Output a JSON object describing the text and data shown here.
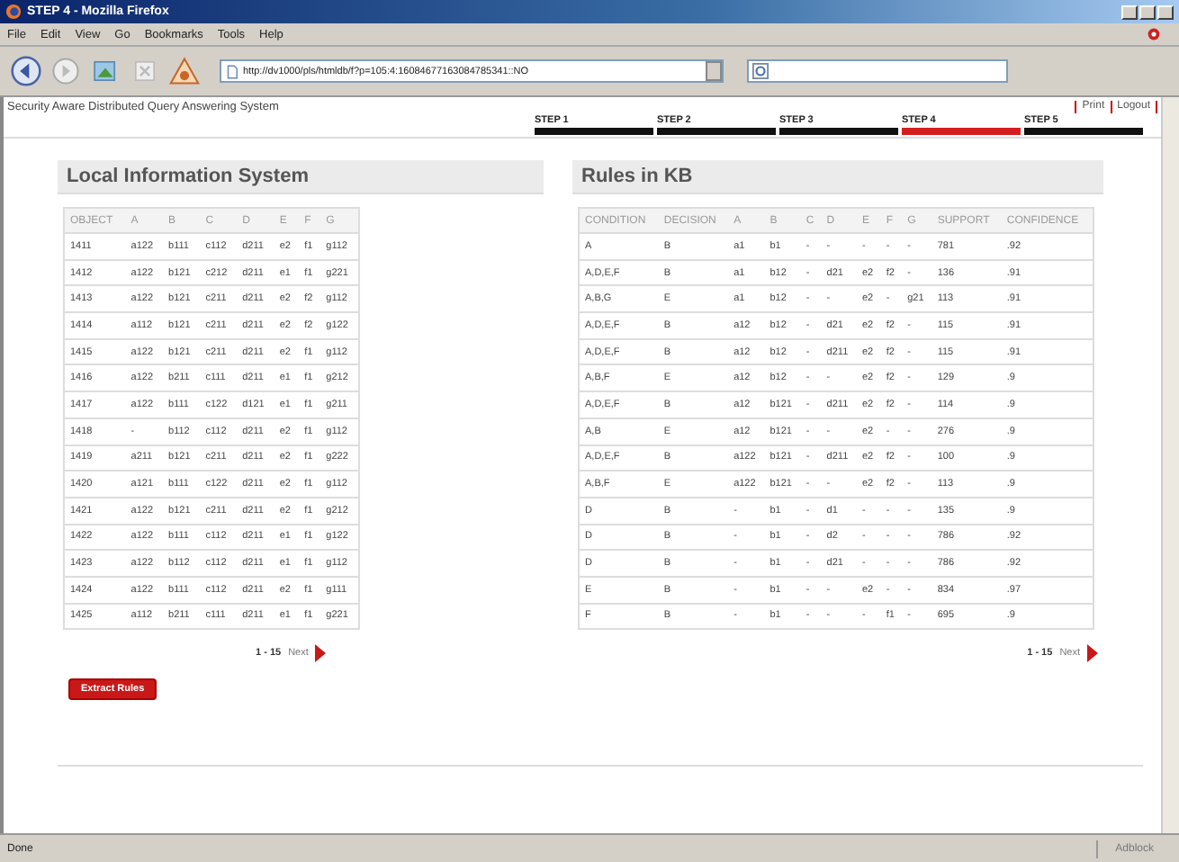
{
  "window": {
    "title": "STEP 4 - Mozilla Firefox",
    "menu": [
      "File",
      "Edit",
      "View",
      "Go",
      "Bookmarks",
      "Tools",
      "Help"
    ],
    "address": "http://dv1000/pls/htmldb/f?p=105:4:16084677163084785341::NO",
    "status": "Done",
    "status_addon": "Adblock"
  },
  "page": {
    "app_title": "Security Aware Distributed Query Answering System",
    "links": [
      "Print",
      "Logout"
    ],
    "steps": [
      {
        "label": "STEP 1",
        "selected": false
      },
      {
        "label": "STEP 2",
        "selected": false
      },
      {
        "label": "STEP 3",
        "selected": false
      },
      {
        "label": "STEP 4",
        "selected": true
      },
      {
        "label": "STEP 5",
        "selected": false
      }
    ],
    "local": {
      "title": "Local Information System",
      "columns": [
        "OBJECT",
        "A",
        "B",
        "C",
        "D",
        "E",
        "F",
        "G"
      ],
      "rows": [
        [
          "1411",
          "a122",
          "b111",
          "c112",
          "d211",
          "e2",
          "f1",
          "g112"
        ],
        [
          "1412",
          "a122",
          "b121",
          "c212",
          "d211",
          "e1",
          "f1",
          "g221"
        ],
        [
          "1413",
          "a122",
          "b121",
          "c211",
          "d211",
          "e2",
          "f2",
          "g112"
        ],
        [
          "1414",
          "a112",
          "b121",
          "c211",
          "d211",
          "e2",
          "f2",
          "g122"
        ],
        [
          "1415",
          "a122",
          "b121",
          "c211",
          "d211",
          "e2",
          "f1",
          "g112"
        ],
        [
          "1416",
          "a122",
          "b211",
          "c111",
          "d211",
          "e1",
          "f1",
          "g212"
        ],
        [
          "1417",
          "a122",
          "b111",
          "c122",
          "d121",
          "e1",
          "f1",
          "g211"
        ],
        [
          "1418",
          "-",
          "b112",
          "c112",
          "d211",
          "e2",
          "f1",
          "g112"
        ],
        [
          "1419",
          "a211",
          "b121",
          "c211",
          "d211",
          "e2",
          "f1",
          "g222"
        ],
        [
          "1420",
          "a121",
          "b111",
          "c122",
          "d211",
          "e2",
          "f1",
          "g112"
        ],
        [
          "1421",
          "a122",
          "b121",
          "c211",
          "d211",
          "e2",
          "f1",
          "g212"
        ],
        [
          "1422",
          "a122",
          "b111",
          "c112",
          "d211",
          "e1",
          "f1",
          "g122"
        ],
        [
          "1423",
          "a122",
          "b112",
          "c112",
          "d211",
          "e1",
          "f1",
          "g112"
        ],
        [
          "1424",
          "a122",
          "b111",
          "c112",
          "d211",
          "e2",
          "f1",
          "g111"
        ],
        [
          "1425",
          "a112",
          "b211",
          "c111",
          "d211",
          "e1",
          "f1",
          "g221"
        ]
      ],
      "pagination": {
        "range": "1 - 15",
        "next": "Next"
      },
      "button": "Extract Rules"
    },
    "rules": {
      "title": "Rules in KB",
      "columns": [
        "CONDITION",
        "DECISION",
        "A",
        "B",
        "C",
        "D",
        "E",
        "F",
        "G",
        "SUPPORT",
        "CONFIDENCE"
      ],
      "rows": [
        [
          "A",
          "B",
          "a1",
          "b1",
          "-",
          "-",
          "-",
          "-",
          "-",
          "781",
          ".92"
        ],
        [
          "A,D,E,F",
          "B",
          "a1",
          "b12",
          "-",
          "d21",
          "e2",
          "f2",
          "-",
          "136",
          ".91"
        ],
        [
          "A,B,G",
          "E",
          "a1",
          "b12",
          "-",
          "-",
          "e2",
          "-",
          "g21",
          "113",
          ".91"
        ],
        [
          "A,D,E,F",
          "B",
          "a12",
          "b12",
          "-",
          "d21",
          "e2",
          "f2",
          "-",
          "115",
          ".91"
        ],
        [
          "A,D,E,F",
          "B",
          "a12",
          "b12",
          "-",
          "d211",
          "e2",
          "f2",
          "-",
          "115",
          ".91"
        ],
        [
          "A,B,F",
          "E",
          "a12",
          "b12",
          "-",
          "-",
          "e2",
          "f2",
          "-",
          "129",
          ".9"
        ],
        [
          "A,D,E,F",
          "B",
          "a12",
          "b121",
          "-",
          "d211",
          "e2",
          "f2",
          "-",
          "114",
          ".9"
        ],
        [
          "A,B",
          "E",
          "a12",
          "b121",
          "-",
          "-",
          "e2",
          "-",
          "-",
          "276",
          ".9"
        ],
        [
          "A,D,E,F",
          "B",
          "a122",
          "b121",
          "-",
          "d211",
          "e2",
          "f2",
          "-",
          "100",
          ".9"
        ],
        [
          "A,B,F",
          "E",
          "a122",
          "b121",
          "-",
          "-",
          "e2",
          "f2",
          "-",
          "113",
          ".9"
        ],
        [
          "D",
          "B",
          "-",
          "b1",
          "-",
          "d1",
          "-",
          "-",
          "-",
          "135",
          ".9"
        ],
        [
          "D",
          "B",
          "-",
          "b1",
          "-",
          "d2",
          "-",
          "-",
          "-",
          "786",
          ".92"
        ],
        [
          "D",
          "B",
          "-",
          "b1",
          "-",
          "d21",
          "-",
          "-",
          "-",
          "786",
          ".92"
        ],
        [
          "E",
          "B",
          "-",
          "b1",
          "-",
          "-",
          "e2",
          "-",
          "-",
          "834",
          ".97"
        ],
        [
          "F",
          "B",
          "-",
          "b1",
          "-",
          "-",
          "-",
          "f1",
          "-",
          "695",
          ".9"
        ]
      ],
      "pagination": {
        "range": "1 - 15",
        "next": "Next"
      }
    }
  }
}
